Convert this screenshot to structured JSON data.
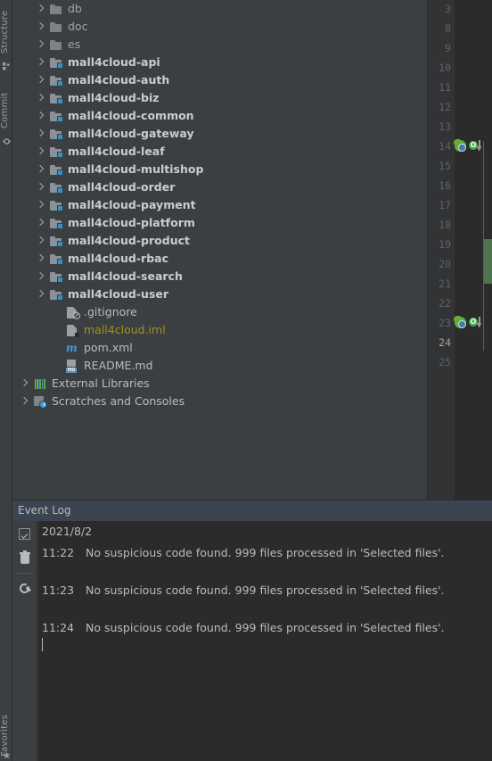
{
  "window": {
    "background": "#3c3f41",
    "editor_background": "#2b2b2b"
  },
  "left_tool_strip": {
    "tabs": [
      {
        "label": "Structure",
        "icon": "structure-icon"
      },
      {
        "label": "Commit",
        "icon": "commit-icon"
      },
      {
        "label": "Favorites",
        "icon": "favorites-icon"
      }
    ]
  },
  "project_tree": {
    "items": [
      {
        "label": "db",
        "kind": "folder",
        "icon": "folder-icon",
        "expandable": true,
        "indent": 1
      },
      {
        "label": "doc",
        "kind": "folder",
        "icon": "folder-icon",
        "expandable": true,
        "indent": 1
      },
      {
        "label": "es",
        "kind": "folder",
        "icon": "folder-icon",
        "expandable": true,
        "indent": 1
      },
      {
        "label": "mall4cloud-api",
        "kind": "module",
        "icon": "module-folder-icon",
        "expandable": true,
        "indent": 1
      },
      {
        "label": "mall4cloud-auth",
        "kind": "module",
        "icon": "module-folder-icon",
        "expandable": true,
        "indent": 1
      },
      {
        "label": "mall4cloud-biz",
        "kind": "module",
        "icon": "module-folder-icon",
        "expandable": true,
        "indent": 1
      },
      {
        "label": "mall4cloud-common",
        "kind": "module",
        "icon": "module-folder-icon",
        "expandable": true,
        "indent": 1
      },
      {
        "label": "mall4cloud-gateway",
        "kind": "module",
        "icon": "module-folder-icon",
        "expandable": true,
        "indent": 1
      },
      {
        "label": "mall4cloud-leaf",
        "kind": "module",
        "icon": "module-folder-icon",
        "expandable": true,
        "indent": 1
      },
      {
        "label": "mall4cloud-multishop",
        "kind": "module",
        "icon": "module-folder-icon",
        "expandable": true,
        "indent": 1
      },
      {
        "label": "mall4cloud-order",
        "kind": "module",
        "icon": "module-folder-icon",
        "expandable": true,
        "indent": 1
      },
      {
        "label": "mall4cloud-payment",
        "kind": "module",
        "icon": "module-folder-icon",
        "expandable": true,
        "indent": 1
      },
      {
        "label": "mall4cloud-platform",
        "kind": "module",
        "icon": "module-folder-icon",
        "expandable": true,
        "indent": 1
      },
      {
        "label": "mall4cloud-product",
        "kind": "module",
        "icon": "module-folder-icon",
        "expandable": true,
        "indent": 1
      },
      {
        "label": "mall4cloud-rbac",
        "kind": "module",
        "icon": "module-folder-icon",
        "expandable": true,
        "indent": 1
      },
      {
        "label": "mall4cloud-search",
        "kind": "module",
        "icon": "module-folder-icon",
        "expandable": true,
        "indent": 1
      },
      {
        "label": "mall4cloud-user",
        "kind": "module",
        "icon": "module-folder-icon",
        "expandable": true,
        "indent": 1
      },
      {
        "label": ".gitignore",
        "kind": "file-gitignore",
        "icon": "gitignore-file-icon",
        "expandable": false,
        "indent": 2
      },
      {
        "label": "mall4cloud.iml",
        "kind": "file-iml",
        "icon": "iml-file-icon",
        "expandable": false,
        "indent": 2
      },
      {
        "label": "pom.xml",
        "kind": "file-maven",
        "icon": "maven-pom-icon",
        "expandable": false,
        "indent": 2
      },
      {
        "label": "README.md",
        "kind": "file-md",
        "icon": "markdown-file-icon",
        "expandable": false,
        "indent": 2
      },
      {
        "label": "External Libraries",
        "kind": "libraries",
        "icon": "external-libraries-icon",
        "expandable": true,
        "indent": 0
      },
      {
        "label": "Scratches and Consoles",
        "kind": "scratches",
        "icon": "scratches-icon",
        "expandable": true,
        "indent": 0
      }
    ],
    "colors": {
      "folder": "#8a9198",
      "module_badge": "#3592c4",
      "iml_text": "#9f9421",
      "module_text": "#c8cdd2",
      "plain_text": "#a3a3a3"
    }
  },
  "editor_gutter": {
    "line_numbers": [
      3,
      8,
      9,
      10,
      11,
      12,
      13,
      14,
      15,
      16,
      17,
      18,
      19,
      20,
      21,
      22,
      23,
      24,
      25
    ],
    "current_line": 24,
    "marked_lines": [
      14,
      23
    ],
    "gutter_icons": [
      {
        "line": 14,
        "icons": [
          "spring-bean-icon",
          "overridden-method-icon"
        ]
      },
      {
        "line": 23,
        "icons": [
          "spring-bean-icon",
          "overridden-method-icon"
        ]
      }
    ],
    "overridden_badge_text": "O",
    "vcs_change_marker_color": "#4f7250",
    "code_guide_color": "#4d7a6e"
  },
  "event_log": {
    "title": "Event Log",
    "header_background": "#3c4452",
    "toolbar": [
      {
        "name": "mark-all-read-button",
        "icon": "checkbox-icon"
      },
      {
        "name": "clear-all-button",
        "icon": "trash-icon"
      },
      {
        "name": "settings-button",
        "icon": "wrench-icon"
      }
    ],
    "date": "2021/8/2",
    "entries": [
      {
        "time": "11:22",
        "message": "No suspicious code found. 999 files processed in 'Selected files'."
      },
      {
        "time": "11:23",
        "message": "No suspicious code found. 999 files processed in 'Selected files'."
      },
      {
        "time": "11:24",
        "message": "No suspicious code found. 999 files processed in 'Selected files'."
      }
    ]
  }
}
